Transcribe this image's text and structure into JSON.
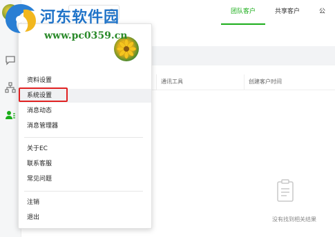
{
  "tabs": [
    "团队客户",
    "共享客户",
    "公"
  ],
  "table_headers": [
    "通讯工具",
    "创建客户时间"
  ],
  "empty_text": "没有找到相关结果",
  "menu": {
    "group1": [
      "资料设置",
      "系统设置",
      "消息动态",
      "消息管理器"
    ],
    "group2": [
      "关于EC",
      "联系客服",
      "常见问题"
    ],
    "group3": [
      "注销",
      "退出"
    ]
  },
  "watermark": {
    "title": "河东软件园",
    "url": "www.pc0359.cn"
  },
  "colors": {
    "accent": "#1aad19",
    "highlight_border": "#e02020",
    "watermark_blue": "#1f73c8"
  }
}
